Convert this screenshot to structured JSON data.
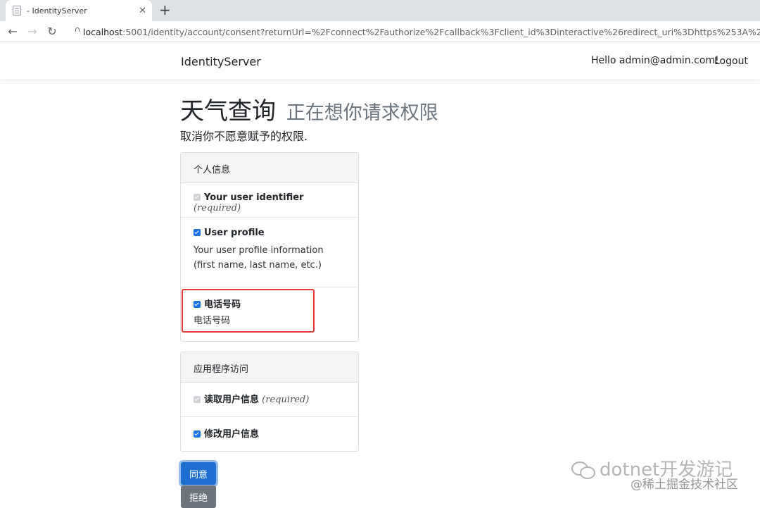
{
  "browser": {
    "tab_title": "- IdentityServer",
    "close_glyph": "✕",
    "new_tab_glyph": "+",
    "url_host": "localhost",
    "url_rest": ":5001/identity/account/consent?returnUrl=%2Fconnect%2Fauthorize%2Fcallback%3Fclient_id%3Dinteractive%26redirect_uri%3Dhttps%253A%252F%252Fl"
  },
  "navbar": {
    "brand": "IdentityServer",
    "greeting": "Hello admin@admin.com!",
    "logout": "Logout"
  },
  "page": {
    "client_name": "天气查询",
    "request_text": "正在想你请求权限",
    "lead": "取消你不愿意赋予的权限."
  },
  "personal_info": {
    "header": "个人信息",
    "scopes": [
      {
        "label": "Your user identifier",
        "required": "(required)",
        "checked": true,
        "disabled": true,
        "description": ""
      },
      {
        "label": "User profile",
        "required": "",
        "checked": true,
        "disabled": false,
        "description": "Your user profile information (first name, last name, etc.)"
      },
      {
        "label": "电话号码",
        "required": "",
        "checked": true,
        "disabled": false,
        "description": "电话号码"
      }
    ]
  },
  "app_access": {
    "header": "应用程序访问",
    "scopes": [
      {
        "label": "读取用户信息",
        "required": "(required)",
        "checked": true,
        "disabled": true
      },
      {
        "label": "修改用户信息",
        "required": "",
        "checked": true,
        "disabled": false
      }
    ]
  },
  "buttons": {
    "allow": "同意",
    "deny": "拒绝"
  },
  "watermark": {
    "line1": "dotnet开发游记",
    "line2": "@稀土掘金技术社区"
  },
  "colors": {
    "primary": "#1e6fd0",
    "secondary": "#6c757d",
    "highlight": "#e53935"
  }
}
